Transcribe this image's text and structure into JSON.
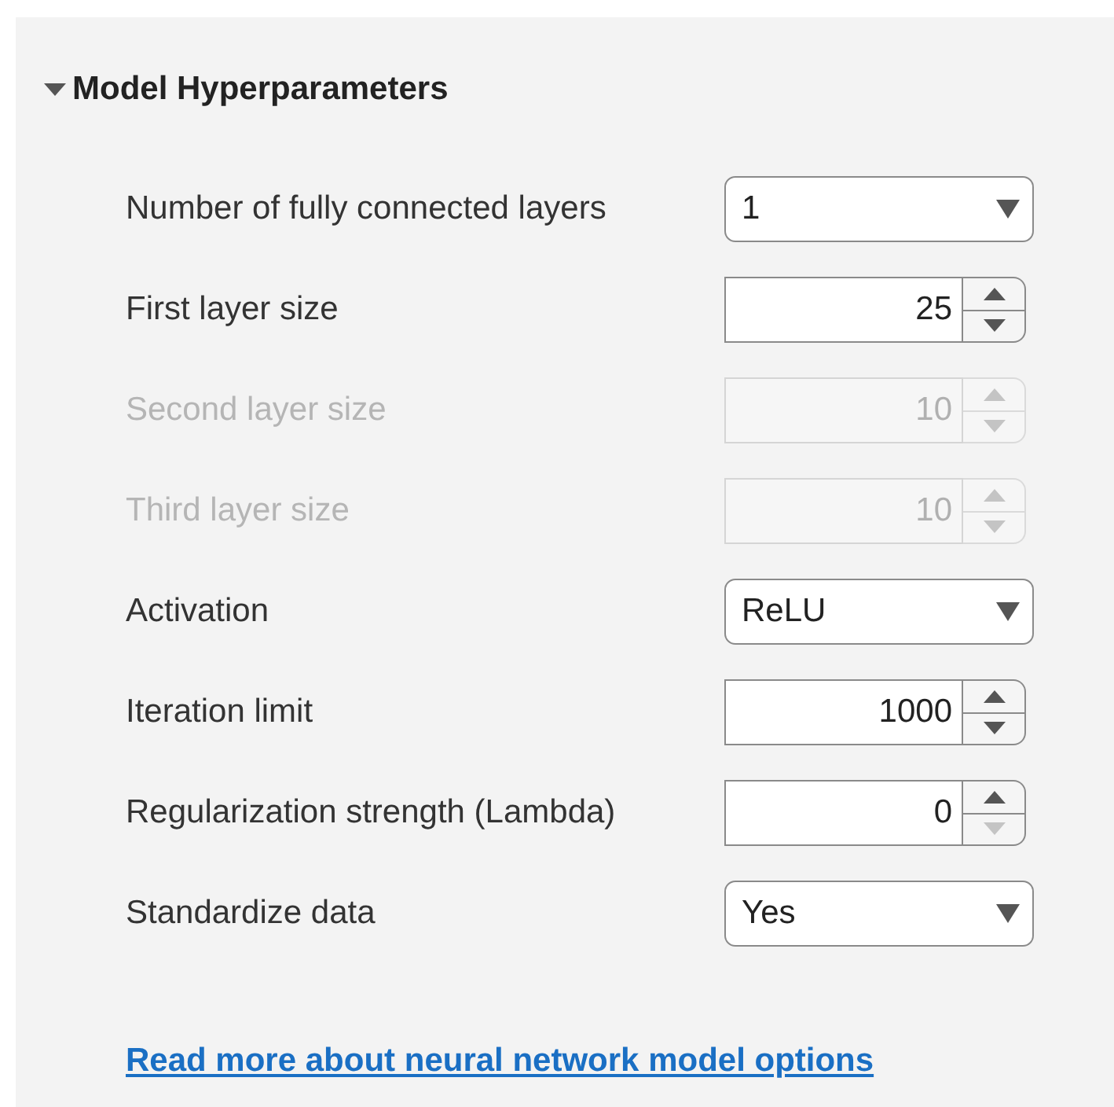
{
  "section": {
    "title": "Model Hyperparameters",
    "expanded": true
  },
  "rows": [
    {
      "kind": "dropdown",
      "label": "Number of fully connected layers",
      "value": "1",
      "disabled": false
    },
    {
      "kind": "spinner",
      "label": "First layer size",
      "value": "25",
      "disabled": false,
      "down_disabled": false
    },
    {
      "kind": "spinner",
      "label": "Second layer size",
      "value": "10",
      "disabled": true
    },
    {
      "kind": "spinner",
      "label": "Third layer size",
      "value": "10",
      "disabled": true
    },
    {
      "kind": "dropdown",
      "label": "Activation",
      "value": "ReLU",
      "disabled": false
    },
    {
      "kind": "spinner",
      "label": "Iteration limit",
      "value": "1000",
      "disabled": false,
      "down_disabled": false
    },
    {
      "kind": "spinner",
      "label": "Regularization strength (Lambda)",
      "value": "0",
      "disabled": false,
      "down_disabled": true
    },
    {
      "kind": "dropdown",
      "label": "Standardize data",
      "value": "Yes",
      "disabled": false
    }
  ],
  "link": "Read more about neural network model options"
}
